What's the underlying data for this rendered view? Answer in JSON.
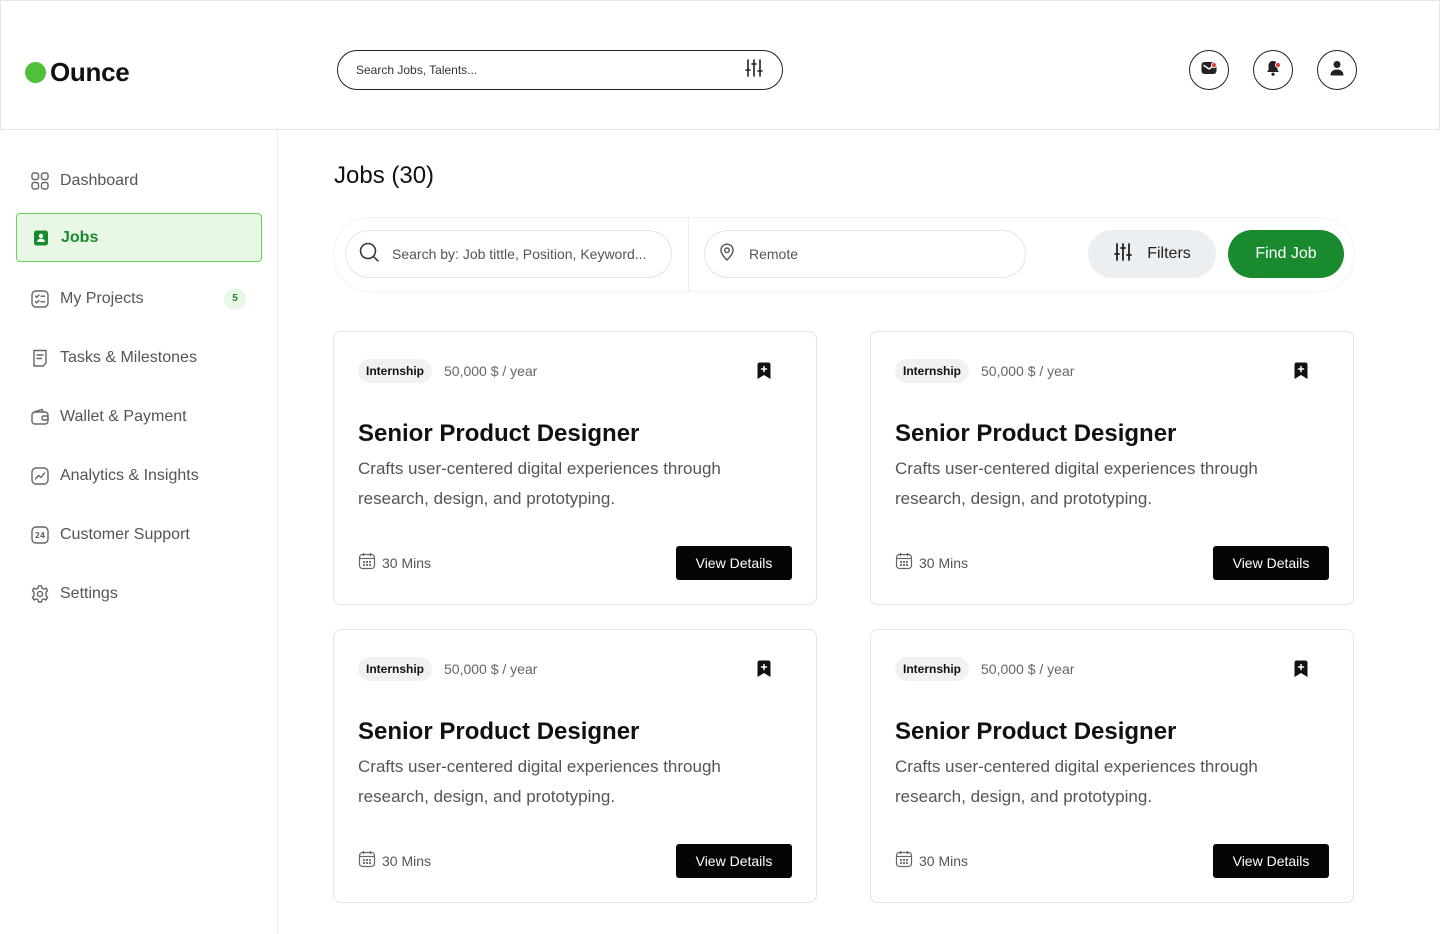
{
  "header": {
    "logo_text": "Ounce",
    "search_placeholder": "Search Jobs, Talents...",
    "icons": [
      "mail-icon",
      "bell-icon",
      "user-icon"
    ]
  },
  "sidebar": {
    "items": [
      {
        "label": "Dashboard",
        "icon": "grid-icon"
      },
      {
        "label": "Jobs",
        "icon": "job-badge-icon",
        "active": true
      },
      {
        "label": "My Projects",
        "icon": "checklist-icon",
        "badge": "5"
      },
      {
        "label": "Tasks & Milestones",
        "icon": "clipboard-icon"
      },
      {
        "label": "Wallet & Payment",
        "icon": "wallet-icon"
      },
      {
        "label": "Analytics & Insights",
        "icon": "chart-icon"
      },
      {
        "label": "Customer Support",
        "icon": "support-24-icon"
      },
      {
        "label": "Settings",
        "icon": "gear-icon"
      }
    ]
  },
  "main": {
    "title": "Jobs (30)",
    "search": {
      "keyword_placeholder": "Search by: Job tittle, Position, Keyword...",
      "location_placeholder": "Remote",
      "filters_label": "Filters",
      "find_label": "Find Job"
    },
    "jobs": [
      {
        "tag": "Internship",
        "salary": "50,000 $ / year",
        "title": "Senior Product Designer",
        "description": "Crafts user-centered digital experiences through research, design, and prototyping.",
        "duration": "30 Mins",
        "button": "View Details"
      },
      {
        "tag": "Internship",
        "salary": "50,000 $ / year",
        "title": "Senior Product Designer",
        "description": "Crafts user-centered digital experiences through research, design, and prototyping.",
        "duration": "30 Mins",
        "button": "View Details"
      },
      {
        "tag": "Internship",
        "salary": "50,000 $ / year",
        "title": "Senior Product Designer",
        "description": "Crafts user-centered digital experiences through research, design, and prototyping.",
        "duration": "30 Mins",
        "button": "View Details"
      },
      {
        "tag": "Internship",
        "salary": "50,000 $ / year",
        "title": "Senior Product Designer",
        "description": "Crafts user-centered digital experiences through research, design, and prototyping.",
        "duration": "30 Mins",
        "button": "View Details"
      }
    ]
  },
  "colors": {
    "brand_green": "#1a8a2f",
    "logo_green": "#4fbf3c",
    "active_bg": "#e9f8e6",
    "notification_dot": "#e53935"
  }
}
